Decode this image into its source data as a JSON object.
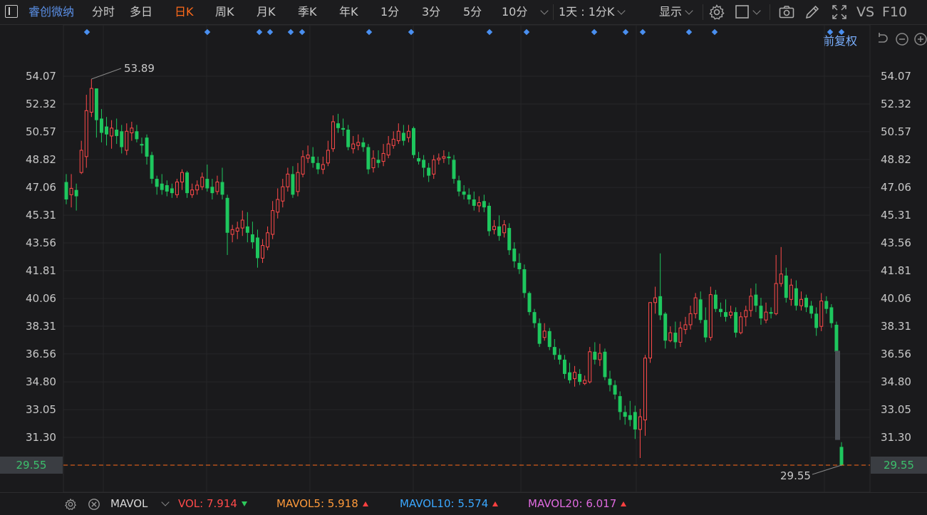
{
  "toolbar": {
    "stock_name": "睿创微纳",
    "periods": [
      "分时",
      "多日",
      "日K",
      "周K",
      "月K",
      "季K",
      "年K",
      "1分",
      "3分",
      "5分",
      "10分"
    ],
    "active_period": "日K",
    "range_select": "1天 : 1分K",
    "display_label": "显示",
    "vs_label": "VS",
    "f10_label": "F10"
  },
  "chart_header": {
    "adjust_label": "前复权"
  },
  "chart_data": {
    "type": "candlestick",
    "y_ticks": [
      "54.07",
      "52.32",
      "50.57",
      "48.82",
      "47.06",
      "45.31",
      "43.56",
      "41.81",
      "40.06",
      "38.31",
      "36.56",
      "34.80",
      "33.05",
      "31.30",
      "29.55"
    ],
    "ylim": [
      29.55,
      54.07
    ],
    "last_price": "29.55",
    "high_annotation": "53.89",
    "low_annotation": "29.55",
    "colors": {
      "up": "#ff4a4a",
      "down": "#1ec75e",
      "dash": "#ff6a1a",
      "marker": "#4a8ff0"
    },
    "candles": [
      [
        47.4,
        46.3,
        47.9,
        46.0
      ],
      [
        46.6,
        47.0,
        47.9,
        45.8
      ],
      [
        46.9,
        46.5,
        47.3,
        45.6
      ],
      [
        48.0,
        49.4,
        50.0,
        47.9
      ],
      [
        49.0,
        51.9,
        52.9,
        48.3
      ],
      [
        51.8,
        53.3,
        53.89,
        51.5
      ],
      [
        53.3,
        51.3,
        53.3,
        50.2
      ],
      [
        51.4,
        50.5,
        52.0,
        49.9
      ],
      [
        50.9,
        50.4,
        51.5,
        49.7
      ],
      [
        50.3,
        50.8,
        51.3,
        49.5
      ],
      [
        50.7,
        50.3,
        51.4,
        49.8
      ],
      [
        50.6,
        49.6,
        51.0,
        49.2
      ],
      [
        49.4,
        50.6,
        51.1,
        49.1
      ],
      [
        50.5,
        50.8,
        51.2,
        50.0
      ],
      [
        50.6,
        50.1,
        51.0,
        49.9
      ],
      [
        49.8,
        49.7,
        50.2,
        49.2
      ],
      [
        50.2,
        49.0,
        50.4,
        48.5
      ],
      [
        49.1,
        47.6,
        49.3,
        47.3
      ],
      [
        47.6,
        47.1,
        47.8,
        46.6
      ],
      [
        47.3,
        46.9,
        47.9,
        46.6
      ],
      [
        47.2,
        46.8,
        47.5,
        46.5
      ],
      [
        47.0,
        46.7,
        47.3,
        46.4
      ],
      [
        46.6,
        47.4,
        47.6,
        46.4
      ],
      [
        47.4,
        48.0,
        48.2,
        46.9
      ],
      [
        48.0,
        46.7,
        48.1,
        46.4
      ],
      [
        46.6,
        46.9,
        47.3,
        46.4
      ],
      [
        46.9,
        47.2,
        47.5,
        46.6
      ],
      [
        47.1,
        47.7,
        48.0,
        46.9
      ],
      [
        47.6,
        47.0,
        48.5,
        46.8
      ],
      [
        47.1,
        46.7,
        47.6,
        46.3
      ],
      [
        46.8,
        47.4,
        47.8,
        46.6
      ],
      [
        47.4,
        46.6,
        48.3,
        46.3
      ],
      [
        46.4,
        44.2,
        46.6,
        42.8
      ],
      [
        44.1,
        44.4,
        44.7,
        43.6
      ],
      [
        44.3,
        44.5,
        44.9,
        43.8
      ],
      [
        44.5,
        45.0,
        45.6,
        44.0
      ],
      [
        44.6,
        44.2,
        45.5,
        43.6
      ],
      [
        44.1,
        43.6,
        44.9,
        43.2
      ],
      [
        43.9,
        42.6,
        44.4,
        42.0
      ],
      [
        42.6,
        43.4,
        43.8,
        42.3
      ],
      [
        43.3,
        44.2,
        44.6,
        43.1
      ],
      [
        44.1,
        45.6,
        46.2,
        43.8
      ],
      [
        45.5,
        46.3,
        47.0,
        45.1
      ],
      [
        46.2,
        47.1,
        47.6,
        45.8
      ],
      [
        47.1,
        47.9,
        48.3,
        46.8
      ],
      [
        47.9,
        46.6,
        48.4,
        46.4
      ],
      [
        46.8,
        48.0,
        48.6,
        46.5
      ],
      [
        47.9,
        49.0,
        49.4,
        47.7
      ],
      [
        48.9,
        49.1,
        49.7,
        48.6
      ],
      [
        49.0,
        48.6,
        49.6,
        48.3
      ],
      [
        48.6,
        48.2,
        49.0,
        47.9
      ],
      [
        48.2,
        48.5,
        49.0,
        47.9
      ],
      [
        48.6,
        49.4,
        50.0,
        48.4
      ],
      [
        49.5,
        51.2,
        51.6,
        49.3
      ],
      [
        51.1,
        50.8,
        51.7,
        50.5
      ],
      [
        50.8,
        50.7,
        51.4,
        50.3
      ],
      [
        50.7,
        49.6,
        51.0,
        49.4
      ],
      [
        49.5,
        49.8,
        50.3,
        49.2
      ],
      [
        49.7,
        49.9,
        50.4,
        49.4
      ],
      [
        49.9,
        49.6,
        50.2,
        49.3
      ],
      [
        49.6,
        48.2,
        49.8,
        47.9
      ],
      [
        48.3,
        48.9,
        49.4,
        48.0
      ],
      [
        48.8,
        48.6,
        49.4,
        48.3
      ],
      [
        48.7,
        49.2,
        49.8,
        48.4
      ],
      [
        49.1,
        49.8,
        50.3,
        48.9
      ],
      [
        49.7,
        50.1,
        50.6,
        49.5
      ],
      [
        50.0,
        50.6,
        51.1,
        49.8
      ],
      [
        50.5,
        50.0,
        51.0,
        49.7
      ],
      [
        50.2,
        50.6,
        51.0,
        49.9
      ],
      [
        50.8,
        49.1,
        50.9,
        48.9
      ],
      [
        48.9,
        48.7,
        49.3,
        48.5
      ],
      [
        48.8,
        48.3,
        49.1,
        47.7
      ],
      [
        48.3,
        47.8,
        48.6,
        47.4
      ],
      [
        47.9,
        48.8,
        49.1,
        47.6
      ],
      [
        48.8,
        48.9,
        49.2,
        48.5
      ],
      [
        48.9,
        49.0,
        49.4,
        48.6
      ],
      [
        49.0,
        48.9,
        49.3,
        48.5
      ],
      [
        48.8,
        47.6,
        49.1,
        47.3
      ],
      [
        47.5,
        46.8,
        47.8,
        46.5
      ],
      [
        46.8,
        46.6,
        47.2,
        46.3
      ],
      [
        46.6,
        46.3,
        47.0,
        46.0
      ],
      [
        46.3,
        45.9,
        46.8,
        45.6
      ],
      [
        45.9,
        46.1,
        46.5,
        45.5
      ],
      [
        46.2,
        45.8,
        46.6,
        45.5
      ],
      [
        45.9,
        44.3,
        46.1,
        44.0
      ],
      [
        44.4,
        44.6,
        45.0,
        44.1
      ],
      [
        44.6,
        44.0,
        45.3,
        43.7
      ],
      [
        44.2,
        44.7,
        45.0,
        43.9
      ],
      [
        44.5,
        43.1,
        44.8,
        42.8
      ],
      [
        43.2,
        42.4,
        43.6,
        42.0
      ],
      [
        42.3,
        41.9,
        42.9,
        41.6
      ],
      [
        41.9,
        40.4,
        42.2,
        40.1
      ],
      [
        40.4,
        39.2,
        40.5,
        39.0
      ],
      [
        39.2,
        38.5,
        39.4,
        38.2
      ],
      [
        38.5,
        37.2,
        38.8,
        37.0
      ],
      [
        37.6,
        38.0,
        38.5,
        37.4
      ],
      [
        38.0,
        37.0,
        38.2,
        36.8
      ],
      [
        37.0,
        36.5,
        37.5,
        36.2
      ],
      [
        36.5,
        36.2,
        36.9,
        35.9
      ],
      [
        36.2,
        35.3,
        36.5,
        35.0
      ],
      [
        35.4,
        34.9,
        36.0,
        34.7
      ],
      [
        35.0,
        35.4,
        35.8,
        34.5
      ],
      [
        35.3,
        34.8,
        35.6,
        34.6
      ],
      [
        34.7,
        34.9,
        35.2,
        34.6
      ],
      [
        34.8,
        36.7,
        37.0,
        34.7
      ],
      [
        36.7,
        36.2,
        37.3,
        35.9
      ],
      [
        36.2,
        36.6,
        37.2,
        35.8
      ],
      [
        36.7,
        35.1,
        36.9,
        34.9
      ],
      [
        35.0,
        34.6,
        35.5,
        34.2
      ],
      [
        34.6,
        34.0,
        34.9,
        33.7
      ],
      [
        33.9,
        32.9,
        34.2,
        32.4
      ],
      [
        32.9,
        32.6,
        33.3,
        32.1
      ],
      [
        32.7,
        32.4,
        33.6,
        32.0
      ],
      [
        32.9,
        31.8,
        33.3,
        31.2
      ],
      [
        31.8,
        32.6,
        33.1,
        30.0
      ],
      [
        32.4,
        36.3,
        36.5,
        31.4
      ],
      [
        36.3,
        39.8,
        39.8,
        36.0
      ],
      [
        39.8,
        40.1,
        40.8,
        39.1
      ],
      [
        40.2,
        39.0,
        42.9,
        38.7
      ],
      [
        39.1,
        37.4,
        39.2,
        36.9
      ],
      [
        37.4,
        37.9,
        38.3,
        37.3
      ],
      [
        37.9,
        37.3,
        38.6,
        36.9
      ],
      [
        37.3,
        38.2,
        38.6,
        37.0
      ],
      [
        38.1,
        38.4,
        38.9,
        37.8
      ],
      [
        38.4,
        39.1,
        39.6,
        38.1
      ],
      [
        39.1,
        40.1,
        40.4,
        38.8
      ],
      [
        40.0,
        38.7,
        40.5,
        38.5
      ],
      [
        38.7,
        37.6,
        39.5,
        37.3
      ],
      [
        37.6,
        40.3,
        40.8,
        37.4
      ],
      [
        40.3,
        39.4,
        40.6,
        39.2
      ],
      [
        39.4,
        39.2,
        39.8,
        38.9
      ],
      [
        39.2,
        38.9,
        40.0,
        38.6
      ],
      [
        39.0,
        39.2,
        39.6,
        38.8
      ],
      [
        39.2,
        37.9,
        39.5,
        37.6
      ],
      [
        37.9,
        38.9,
        39.2,
        37.8
      ],
      [
        38.9,
        39.3,
        39.6,
        38.3
      ],
      [
        39.3,
        40.2,
        40.7,
        38.9
      ],
      [
        40.3,
        39.6,
        41.0,
        39.2
      ],
      [
        39.6,
        38.8,
        40.1,
        38.4
      ],
      [
        38.7,
        39.2,
        39.8,
        38.5
      ],
      [
        39.2,
        39.1,
        39.5,
        38.8
      ],
      [
        39.1,
        41.0,
        42.8,
        39.0
      ],
      [
        41.0,
        41.6,
        43.3,
        40.8
      ],
      [
        41.5,
        40.1,
        42.0,
        39.8
      ],
      [
        40.0,
        40.9,
        41.3,
        39.6
      ],
      [
        40.7,
        39.6,
        41.2,
        39.3
      ],
      [
        39.6,
        40.0,
        40.5,
        39.3
      ],
      [
        40.1,
        39.5,
        40.3,
        39.2
      ],
      [
        39.6,
        39.1,
        39.9,
        38.8
      ],
      [
        39.1,
        38.2,
        39.5,
        37.7
      ],
      [
        38.3,
        39.9,
        40.4,
        38.0
      ],
      [
        39.9,
        39.4,
        40.2,
        39.1
      ],
      [
        39.5,
        38.5,
        39.7,
        38.2
      ],
      [
        38.4,
        36.7,
        38.6,
        36.5
      ],
      [
        30.7,
        29.55,
        31.0,
        29.5
      ]
    ],
    "markers_count": 17,
    "volume_overlay_bar": [
      36.76,
      31.14
    ]
  },
  "volume": {
    "name": "MAVOL",
    "vol_label": "VOL:",
    "vol_value": "7.914",
    "ma5_label": "MAVOL5:",
    "ma5_value": "5.918",
    "ma10_label": "MAVOL10:",
    "ma10_value": "5.574",
    "ma20_label": "MAVOL20:",
    "ma20_value": "6.017",
    "colors": {
      "vol": "#ff4a4a",
      "ma5": "#ff9a3a",
      "ma10": "#3aa8ff",
      "ma20": "#e06ae0"
    }
  }
}
